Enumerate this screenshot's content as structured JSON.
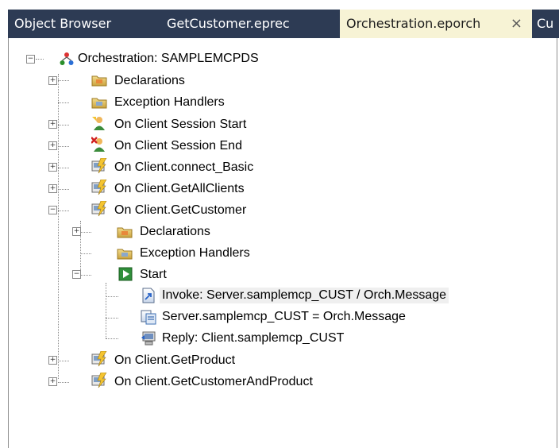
{
  "tabs": [
    {
      "label": "Object Browser",
      "active": false
    },
    {
      "label": "GetCustomer.eprec",
      "active": false
    },
    {
      "label": "Orchestration.eporch",
      "active": true,
      "closable": true
    },
    {
      "label": "Cu",
      "active": false
    }
  ],
  "tab_close_glyph": "×",
  "tree": {
    "root": {
      "label": "Orchestration: SAMPLEMCPDS",
      "icon": "orchestration-icon",
      "expanded": true
    },
    "items": [
      {
        "label": "Declarations",
        "icon": "declarations-folder-icon",
        "expanded": false
      },
      {
        "label": "Exception Handlers",
        "icon": "exception-folder-icon"
      },
      {
        "label": "On Client Session Start",
        "icon": "session-start-icon",
        "expanded": false
      },
      {
        "label": "On Client Session End",
        "icon": "session-end-icon",
        "expanded": false
      },
      {
        "label": "On Client.connect_Basic",
        "icon": "event-handler-icon",
        "expanded": false
      },
      {
        "label": "On Client.GetAllClients",
        "icon": "event-handler-icon",
        "expanded": false
      },
      {
        "label": "On Client.GetCustomer",
        "icon": "event-handler-icon",
        "expanded": true,
        "children": [
          {
            "label": "Declarations",
            "icon": "declarations-folder-icon",
            "expanded": false
          },
          {
            "label": "Exception Handlers",
            "icon": "exception-folder-icon"
          },
          {
            "label": "Start",
            "icon": "start-icon",
            "expanded": true,
            "children": [
              {
                "label": "Invoke: Server.samplemcp_CUST / Orch.Message",
                "icon": "invoke-icon",
                "selected": true
              },
              {
                "label": "Server.samplemcp_CUST = Orch.Message",
                "icon": "assign-icon"
              },
              {
                "label": "Reply: Client.samplemcp_CUST",
                "icon": "reply-icon"
              }
            ]
          }
        ]
      },
      {
        "label": "On Client.GetProduct",
        "icon": "event-handler-icon",
        "expanded": false
      },
      {
        "label": "On Client.GetCustomerAndProduct",
        "icon": "event-handler-icon",
        "expanded": false
      }
    ]
  },
  "toggle_glyphs": {
    "collapsed": "+",
    "expanded": "−"
  }
}
